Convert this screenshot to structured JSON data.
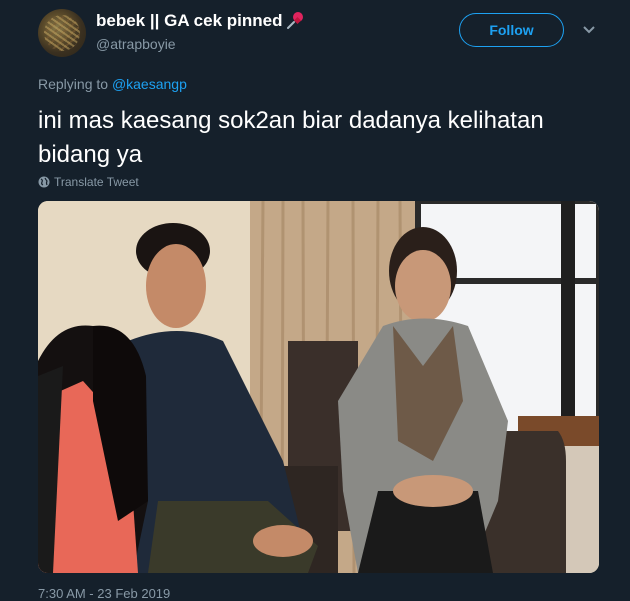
{
  "tweet": {
    "display_name": "bebek || GA cek pinned",
    "handle": "@atrapboyie",
    "follow_label": "Follow",
    "replying_prefix": "Replying to ",
    "replying_to": "@kaesangp",
    "text": "ini mas kaesang sok2an biar dadanya kelihatan bidang ya",
    "translate_label": "Translate Tweet",
    "timestamp": "7:30 AM - 23 Feb 2019"
  },
  "icons": {
    "pin": "pushpin-icon",
    "chevron": "chevron-down-icon",
    "globe": "globe-icon"
  },
  "colors": {
    "background": "#15202b",
    "accent": "#1da1f2",
    "secondary_text": "#8899a6"
  }
}
